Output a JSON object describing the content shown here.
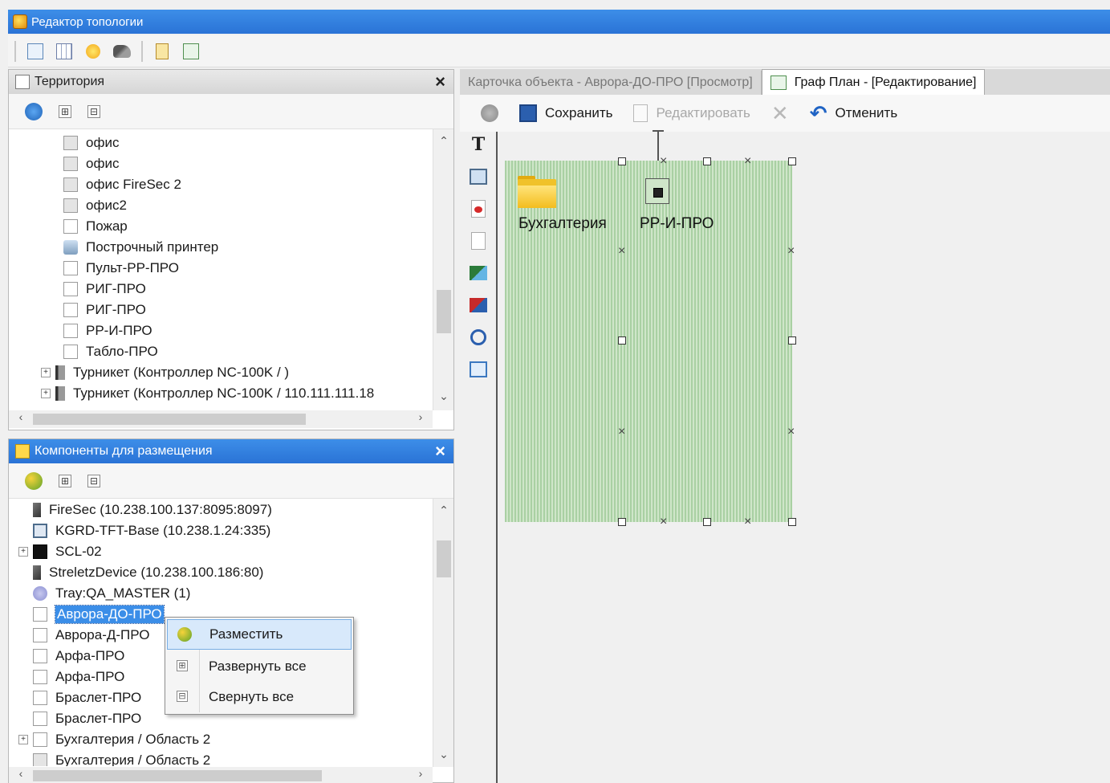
{
  "window": {
    "title": "Редактор топологии"
  },
  "territory_panel": {
    "title": "Территория",
    "close": "×",
    "items": [
      {
        "label": "офис",
        "type": "checkbox-gray",
        "indent": 1
      },
      {
        "label": "офис",
        "type": "checkbox-gray",
        "indent": 1
      },
      {
        "label": "офис FireSec 2",
        "type": "checkbox-gray",
        "indent": 1
      },
      {
        "label": "офис2",
        "type": "checkbox-gray",
        "indent": 1
      },
      {
        "label": "Пожар",
        "type": "checkbox",
        "indent": 1
      },
      {
        "label": "Построчный принтер",
        "type": "printer",
        "indent": 1
      },
      {
        "label": "Пульт-РР-ПРО",
        "type": "checkbox",
        "indent": 1
      },
      {
        "label": "РИГ-ПРО",
        "type": "checkbox",
        "indent": 1
      },
      {
        "label": "РИГ-ПРО",
        "type": "checkbox",
        "indent": 1
      },
      {
        "label": "РР-И-ПРО",
        "type": "checkbox",
        "indent": 1
      },
      {
        "label": "Табло-ПРО",
        "type": "checkbox",
        "indent": 1
      },
      {
        "label": "Турникет (Контроллер NC-100K / )",
        "type": "turnstile",
        "indent": 0
      },
      {
        "label": "Турникет (Контроллер NC-100K / 110.111.111.18",
        "type": "turnstile",
        "indent": 0
      }
    ]
  },
  "components_panel": {
    "title": "Компоненты для размещения",
    "close": "×",
    "items": [
      {
        "label": "FireSec (10.238.100.137:8095:8097)",
        "type": "plug"
      },
      {
        "label": "KGRD-TFT-Base (10.238.1.24:335)",
        "type": "monitor"
      },
      {
        "label": "SCL-02",
        "type": "black",
        "expand": true
      },
      {
        "label": "StreletzDevice (10.238.100.186:80)",
        "type": "plug"
      },
      {
        "label": "Tray:QA_MASTER (1)",
        "type": "tray"
      },
      {
        "label": "Аврора-ДО-ПРО",
        "type": "checkbox",
        "selected": true
      },
      {
        "label": "Аврора-Д-ПРО",
        "type": "checkbox"
      },
      {
        "label": "Арфа-ПРО",
        "type": "checkbox"
      },
      {
        "label": "Арфа-ПРО",
        "type": "checkbox"
      },
      {
        "label": "Браслет-ПРО",
        "type": "checkbox"
      },
      {
        "label": "Браслет-ПРО",
        "type": "checkbox"
      },
      {
        "label": "Бухгалтерия / Область 2",
        "type": "checkbox",
        "expand": true
      },
      {
        "label": "Бухгалтерия / Область 2",
        "type": "checkbox-gray"
      }
    ]
  },
  "context_menu": {
    "items": [
      {
        "label": "Разместить",
        "icon": "leaf-icon",
        "highlighted": true
      },
      {
        "label": "Развернуть все",
        "icon": "expand-icon"
      },
      {
        "label": "Свернуть все",
        "icon": "collapse-icon"
      }
    ]
  },
  "doc_tabs": [
    {
      "label": "Карточка объекта - Аврора-ДО-ПРО [Просмотр]",
      "active": false
    },
    {
      "label": "Граф План - [Редактирование]",
      "active": true
    }
  ],
  "edit_toolbar": {
    "save": "Сохранить",
    "edit": "Редактировать",
    "cancel": "Отменить"
  },
  "canvas": {
    "folder_label": "Бухгалтерия",
    "device_label": "РР-И-ПРО",
    "background_color": "#a9d0a3"
  },
  "colors": {
    "active_header": "#2a73d6",
    "selection": "#3b8ee8"
  }
}
